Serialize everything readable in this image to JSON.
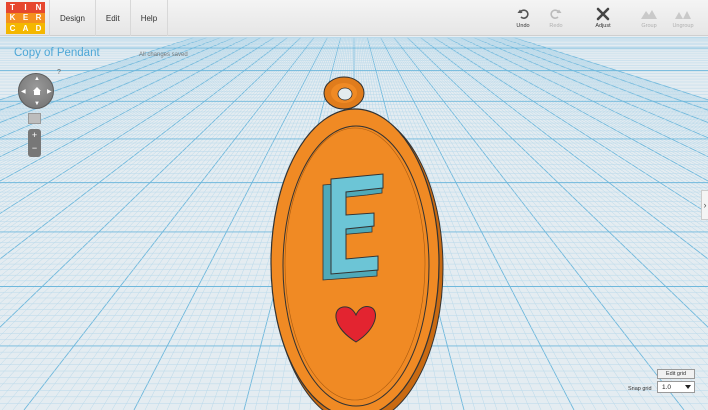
{
  "logo": {
    "letters": [
      "T",
      "I",
      "N",
      "K",
      "E",
      "R",
      "C",
      "A",
      "D"
    ],
    "colors": [
      "#e6462e",
      "#e6462e",
      "#e6462e",
      "#f4901e",
      "#f4901e",
      "#f4901e",
      "#f4b700",
      "#f4b700",
      "#f4b700"
    ]
  },
  "menu": {
    "design": "Design",
    "edit": "Edit",
    "help": "Help"
  },
  "toolbar": {
    "undo": "Undo",
    "redo": "Redo",
    "adjust": "Adjust",
    "group": "Group",
    "ungroup": "Ungroup"
  },
  "document": {
    "title": "Copy of Pendant",
    "status": "All changes saved"
  },
  "help": {
    "q": "?"
  },
  "zoom": {
    "plus": "+",
    "minus": "−"
  },
  "grid": {
    "edit_label": "Edit grid",
    "snap_label": "Snap grid",
    "snap_value": "1.0"
  },
  "model": {
    "letter": "E",
    "body_color": "#f08a24",
    "letter_color": "#6cc5d6",
    "heart_color": "#e32430"
  },
  "colors": {
    "accent": "#4ca6d6",
    "grid_bg": "#dfe9ef"
  }
}
